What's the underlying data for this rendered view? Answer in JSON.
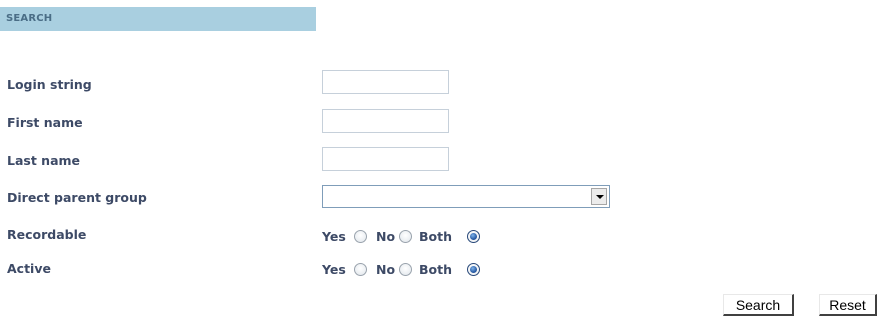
{
  "panel": {
    "title": "SEARCH"
  },
  "fields": {
    "login": {
      "label": "Login string",
      "value": ""
    },
    "first_name": {
      "label": "First name",
      "value": ""
    },
    "last_name": {
      "label": "Last name",
      "value": ""
    },
    "parent_group": {
      "label": "Direct parent group",
      "value": ""
    }
  },
  "recordable": {
    "label": "Recordable",
    "options": [
      "Yes",
      "No",
      "Both"
    ],
    "selected": "Both"
  },
  "active": {
    "label": "Active",
    "options": [
      "Yes",
      "No",
      "Both"
    ],
    "selected": "Both"
  },
  "buttons": {
    "search": "Search",
    "reset": "Reset"
  }
}
